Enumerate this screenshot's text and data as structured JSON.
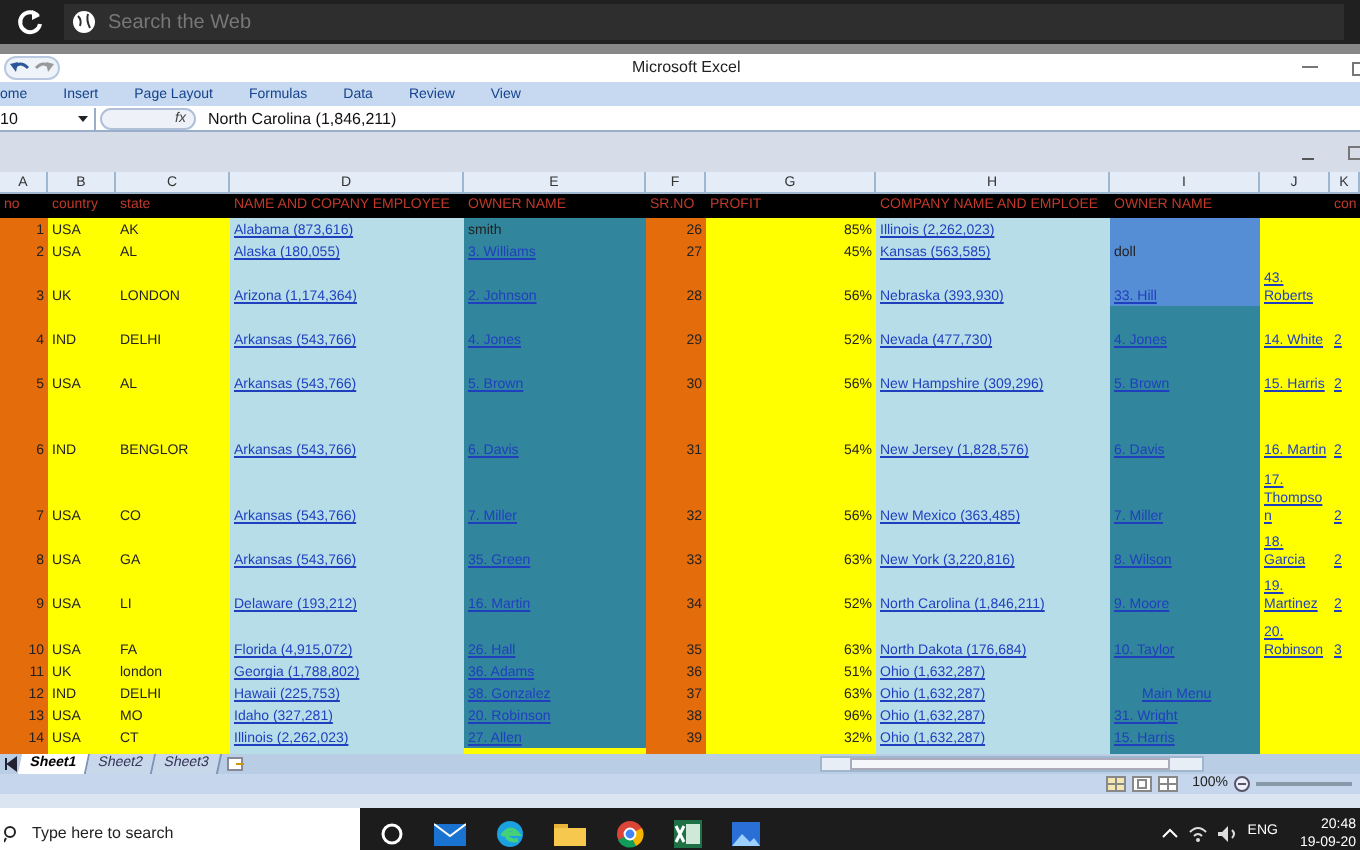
{
  "browser": {
    "search_placeholder": "Search the Web"
  },
  "window": {
    "title": "Microsoft Excel"
  },
  "ribbon_tabs": [
    "ome",
    "Insert",
    "Page Layout",
    "Formulas",
    "Data",
    "Review",
    "View"
  ],
  "name_box": "10",
  "formula_bar": {
    "fx": "fx",
    "value": "North Carolina (1,846,211)"
  },
  "columns": [
    {
      "letter": "A",
      "header": "no",
      "link": false
    },
    {
      "letter": "B",
      "header": "country",
      "link": false
    },
    {
      "letter": "C",
      "header": "state",
      "link": false
    },
    {
      "letter": "D",
      "header": "NAME AND COPANY EMPLOYEE",
      "link": true
    },
    {
      "letter": "E",
      "header": "OWNER NAME",
      "link": true
    },
    {
      "letter": "F",
      "header": "SR.NO",
      "link": false
    },
    {
      "letter": "G",
      "header": "PROFIT",
      "link": false
    },
    {
      "letter": "H",
      "header": "COMPANY NAME AND EMPLOEE",
      "link": true
    },
    {
      "letter": "I",
      "header": "OWNER NAME",
      "link": true
    },
    {
      "letter": "J",
      "link": true
    },
    {
      "letter": "K",
      "header": "con",
      "link": true
    }
  ],
  "rows": [
    [
      "1",
      "USA",
      "AK",
      "Alabama (873,616)",
      {
        "text": "smith",
        "link": false
      },
      "26",
      "85%",
      "Illinois (2,262,023)",
      "",
      "",
      ""
    ],
    [
      "2",
      "USA",
      "AL",
      "Alaska (180,055)",
      "3. Williams",
      "27",
      "45%",
      "Kansas (563,585)",
      {
        "text": "doll",
        "link": false
      },
      "",
      ""
    ],
    [
      "3",
      "UK",
      "LONDON",
      "Arizona (1,174,364)",
      "2. Johnson",
      "28",
      "56%",
      "Nebraska (393,930)",
      "33. Hill",
      "43. Roberts",
      ""
    ],
    [
      "4",
      "IND",
      "DELHI",
      "Arkansas (543,766)",
      "4. Jones",
      "29",
      "52%",
      "Nevada (477,730)",
      "4. Jones",
      "14. White",
      "2"
    ],
    [
      "5",
      "USA",
      "AL",
      "Arkansas (543,766)",
      "5. Brown",
      "30",
      "56%",
      "New Hampshire (309,296)",
      "5. Brown",
      "15. Harris",
      "2"
    ],
    [
      "6",
      "IND",
      "BENGLOR",
      "Arkansas (543,766)",
      "6. Davis",
      "31",
      "54%",
      "New Jersey (1,828,576)",
      "6. Davis",
      "16. Martin",
      "2"
    ],
    [
      "7",
      "USA",
      "CO",
      "Arkansas (543,766)",
      "7. Miller",
      "32",
      "56%",
      "New Mexico (363,485)",
      "7. Miller",
      "17. Thompson",
      "2"
    ],
    [
      "8",
      "USA",
      "GA",
      "Arkansas (543,766)",
      "35. Green",
      "33",
      "63%",
      "New York (3,220,816)",
      "8. Wilson",
      "18. Garcia",
      "2"
    ],
    [
      "9",
      "USA",
      "LI",
      "Delaware (193,212)",
      "16. Martin",
      "34",
      "52%",
      "North Carolina (1,846,211)",
      "9. Moore",
      "19. Martinez",
      "2"
    ],
    [
      "10",
      "USA",
      "FA",
      "Florida (4,915,072)",
      "26. Hall",
      "35",
      "63%",
      "North Dakota (176,684)",
      "10. Taylor",
      "20. Robinson",
      "3"
    ],
    [
      "11",
      "UK",
      "london",
      "Georgia (1,788,802)",
      "36. Adams",
      "36",
      "51%",
      "Ohio (1,632,287)",
      "",
      "",
      ""
    ],
    [
      "12",
      "IND",
      "DELHI",
      "Hawaii (225,753)",
      "38. Gonzalez",
      "37",
      "63%",
      "Ohio (1,632,287)",
      "Main Menu",
      "",
      ""
    ],
    [
      "13",
      "USA",
      "MO",
      "Idaho (327,281)",
      "20. Robinson",
      "38",
      "96%",
      "Ohio (1,632,287)",
      "31. Wright",
      "",
      ""
    ],
    [
      "14",
      "USA",
      "CT",
      "Illinois (2,262,023)",
      "27. Allen",
      "39",
      "32%",
      "Ohio (1,632,287)",
      "15. Harris",
      "",
      ""
    ]
  ],
  "sheet_tabs": [
    {
      "label": "Sheet1",
      "selected": true
    },
    {
      "label": "Sheet2",
      "selected": false
    },
    {
      "label": "Sheet3",
      "selected": false
    }
  ],
  "zoom": "100%",
  "taskbar": {
    "search_placeholder": "Type here to search",
    "language": "ENG",
    "time": "20:48",
    "date": "19-09-20"
  }
}
